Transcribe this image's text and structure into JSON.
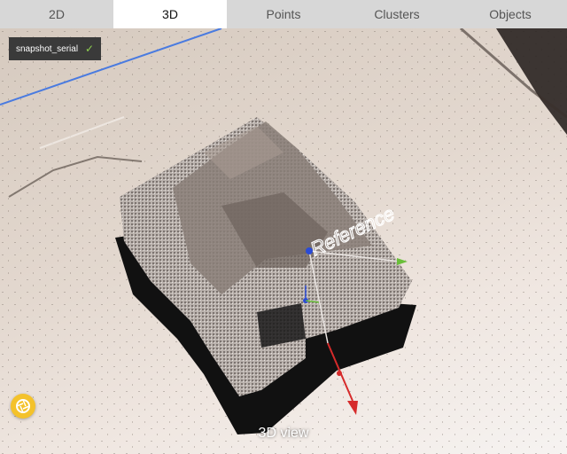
{
  "tabs": [
    {
      "label": "2D",
      "active": false
    },
    {
      "label": "3D",
      "active": true
    },
    {
      "label": "Points",
      "active": false
    },
    {
      "label": "Clusters",
      "active": false
    },
    {
      "label": "Objects",
      "active": false
    }
  ],
  "badge": {
    "text": "snapshot_serial",
    "status": "check-icon"
  },
  "scene": {
    "reference_label": "Reference"
  },
  "view_label": "3D view",
  "colors": {
    "tab_bar": "#d7d7d7",
    "tab_active": "#ffffff",
    "badge_bg": "#3a3a3a",
    "snap_button": "#f4c22b",
    "axis_red": "#d62b2b",
    "axis_green": "#6abf3a",
    "axis_blue": "#2a4bd6"
  }
}
